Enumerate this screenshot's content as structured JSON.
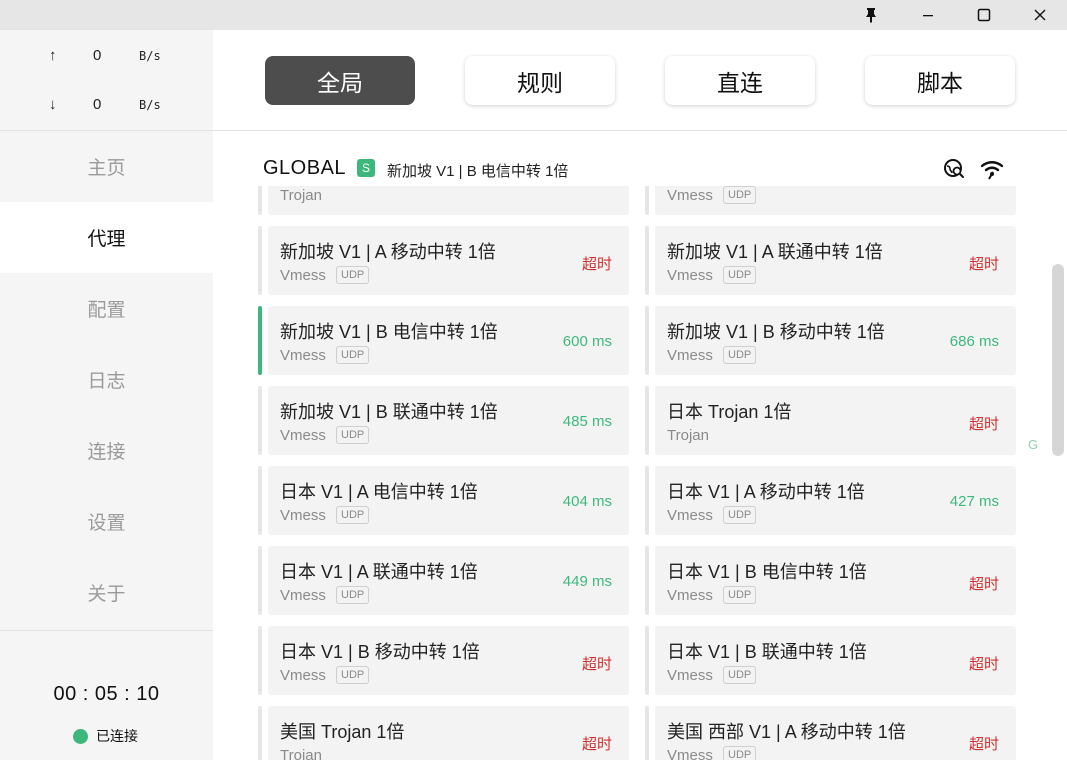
{
  "titlebar": {
    "icons": [
      "pin-icon",
      "minimize-icon",
      "maximize-icon",
      "close-icon"
    ]
  },
  "sidebar": {
    "traffic": {
      "up_arrow": "↑",
      "up_value": "0",
      "up_unit": "B/s",
      "down_arrow": "↓",
      "down_value": "0",
      "down_unit": "B/s"
    },
    "nav": [
      {
        "label": "主页"
      },
      {
        "label": "代理"
      },
      {
        "label": "配置"
      },
      {
        "label": "日志"
      },
      {
        "label": "连接"
      },
      {
        "label": "设置"
      },
      {
        "label": "关于"
      }
    ],
    "active_index": 1,
    "timer": "00 : 05 : 10",
    "status": "已连接",
    "status_color": "#3db87c"
  },
  "modes": [
    {
      "label": "全局",
      "active": true
    },
    {
      "label": "规则",
      "active": false
    },
    {
      "label": "直连",
      "active": false
    },
    {
      "label": "脚本",
      "active": false
    }
  ],
  "group": {
    "name": "GLOBAL",
    "badge": "S",
    "selected": "新加坡 V1 | B 电信中转 1倍",
    "icons": [
      "latency-test-icon",
      "network-signal-icon"
    ]
  },
  "proxies": [
    {
      "name": "",
      "type": "Trojan",
      "udp": "",
      "delay": "",
      "status": ""
    },
    {
      "name": "",
      "type": "Vmess",
      "udp": "UDP",
      "delay": "",
      "status": ""
    },
    {
      "name": "新加坡 V1 | A 移动中转 1倍",
      "type": "Vmess",
      "udp": "UDP",
      "delay": "超时",
      "status": "timeout"
    },
    {
      "name": "新加坡 V1 | A 联通中转 1倍",
      "type": "Vmess",
      "udp": "UDP",
      "delay": "超时",
      "status": "timeout"
    },
    {
      "name": "新加坡 V1 | B 电信中转 1倍",
      "type": "Vmess",
      "udp": "UDP",
      "delay": "600 ms",
      "status": "ok",
      "selected": true
    },
    {
      "name": "新加坡 V1 | B 移动中转 1倍",
      "type": "Vmess",
      "udp": "UDP",
      "delay": "686 ms",
      "status": "ok"
    },
    {
      "name": "新加坡 V1 | B 联通中转 1倍",
      "type": "Vmess",
      "udp": "UDP",
      "delay": "485 ms",
      "status": "ok"
    },
    {
      "name": "日本 Trojan 1倍",
      "type": "Trojan",
      "udp": "",
      "delay": "超时",
      "status": "timeout"
    },
    {
      "name": "日本 V1 | A 电信中转 1倍",
      "type": "Vmess",
      "udp": "UDP",
      "delay": "404 ms",
      "status": "ok"
    },
    {
      "name": "日本 V1 | A 移动中转 1倍",
      "type": "Vmess",
      "udp": "UDP",
      "delay": "427 ms",
      "status": "ok"
    },
    {
      "name": "日本 V1 | A 联通中转 1倍",
      "type": "Vmess",
      "udp": "UDP",
      "delay": "449 ms",
      "status": "ok"
    },
    {
      "name": "日本 V1 | B 电信中转 1倍",
      "type": "Vmess",
      "udp": "UDP",
      "delay": "超时",
      "status": "timeout"
    },
    {
      "name": "日本 V1 | B 移动中转 1倍",
      "type": "Vmess",
      "udp": "UDP",
      "delay": "超时",
      "status": "timeout"
    },
    {
      "name": "日本 V1 | B 联通中转 1倍",
      "type": "Vmess",
      "udp": "UDP",
      "delay": "超时",
      "status": "timeout"
    },
    {
      "name": "美国 Trojan 1倍",
      "type": "Trojan",
      "udp": "",
      "delay": "超时",
      "status": "timeout"
    },
    {
      "name": "美国 西部 V1 | A 移动中转 1倍",
      "type": "Vmess",
      "udp": "UDP",
      "delay": "超时",
      "status": "timeout"
    }
  ],
  "side_letter": "G",
  "colors": {
    "accent": "#3db87c",
    "timeout": "#d12f2f",
    "active_mode": "#4d4d4d"
  }
}
